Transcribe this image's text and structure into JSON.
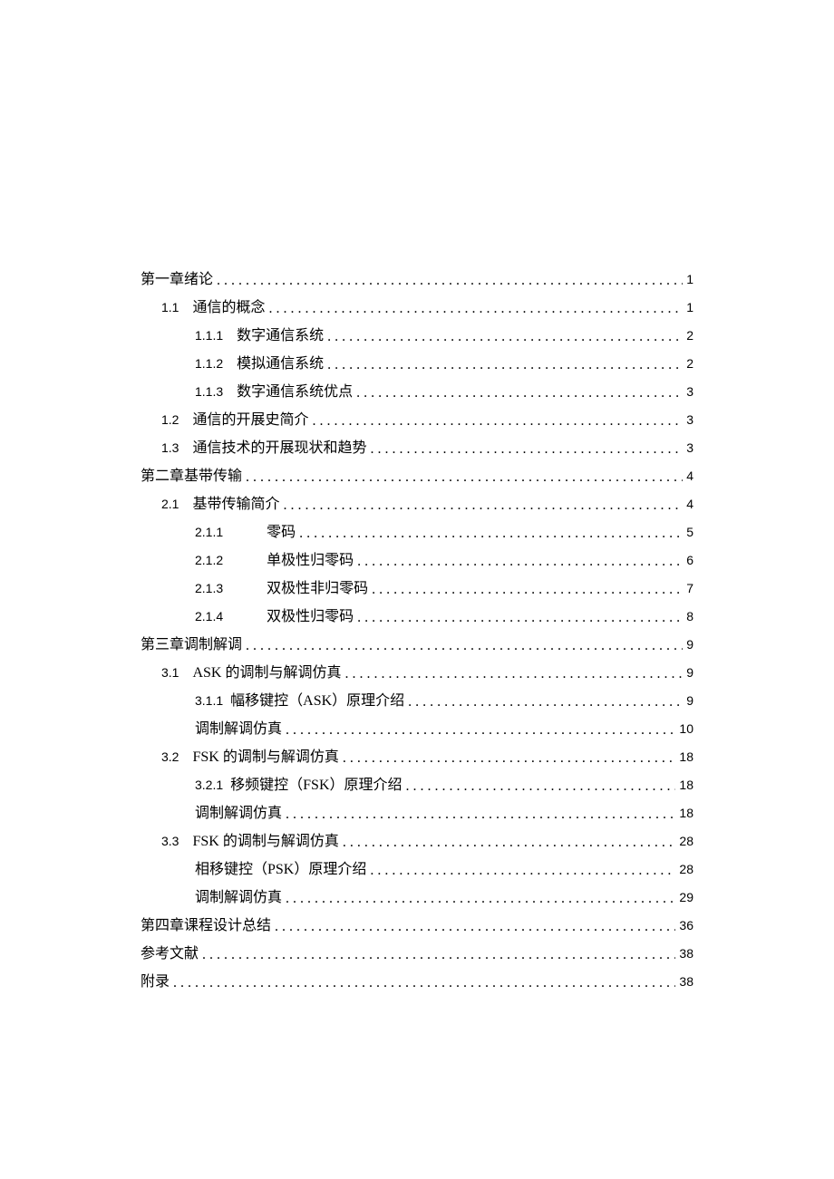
{
  "toc": [
    {
      "indent": 0,
      "num": "",
      "spacer": "sm",
      "title": "第一章绪论",
      "page": "1",
      "numClass": "",
      "titleClass": ""
    },
    {
      "indent": 1,
      "num": "1.1",
      "spacer": "med",
      "title": "通信的概念",
      "page": "1",
      "numClass": "arial",
      "titleClass": ""
    },
    {
      "indent": 2,
      "num": "1.1.1",
      "spacer": "med",
      "title": "数字通信系统",
      "page": "2",
      "numClass": "arial",
      "titleClass": ""
    },
    {
      "indent": 2,
      "num": "1.1.2",
      "spacer": "med",
      "title": "模拟通信系统",
      "page": "2",
      "numClass": "arial",
      "titleClass": ""
    },
    {
      "indent": 2,
      "num": "1.1.3",
      "spacer": "med",
      "title": "数字通信系统优点",
      "page": "3",
      "numClass": "arial",
      "titleClass": ""
    },
    {
      "indent": 1,
      "num": "1.2",
      "spacer": "med",
      "title": "通信的开展史简介",
      "page": "3",
      "numClass": "arial",
      "titleClass": ""
    },
    {
      "indent": 1,
      "num": "1.3",
      "spacer": "med",
      "title": "通信技术的开展现状和趋势",
      "page": "3",
      "numClass": "arial",
      "titleClass": ""
    },
    {
      "indent": 0,
      "num": "",
      "spacer": "sm",
      "title": "第二章基带传输",
      "page": "4",
      "numClass": "",
      "titleClass": ""
    },
    {
      "indent": 1,
      "num": "2.1",
      "spacer": "med",
      "title": "基带传输简介",
      "page": "4",
      "numClass": "arial",
      "titleClass": ""
    },
    {
      "indent": 2,
      "num": "2.1.1",
      "spacer": "wide",
      "title": "零码",
      "page": "5",
      "numClass": "arial",
      "titleClass": ""
    },
    {
      "indent": 2,
      "num": "2.1.2",
      "spacer": "wide",
      "title": "单极性归零码",
      "page": "6",
      "numClass": "arial",
      "titleClass": ""
    },
    {
      "indent": 2,
      "num": "2.1.3",
      "spacer": "wide",
      "title": "双极性非归零码",
      "page": "7",
      "numClass": "arial",
      "titleClass": ""
    },
    {
      "indent": 2,
      "num": "2.1.4",
      "spacer": "wide",
      "title": "双极性归零码",
      "page": "8",
      "numClass": "arial",
      "titleClass": ""
    },
    {
      "indent": 0,
      "num": "",
      "spacer": "sm",
      "title": "第三章调制解调",
      "page": "9",
      "numClass": "",
      "titleClass": ""
    },
    {
      "indent": 1,
      "num": "3.1",
      "spacer": "med",
      "title": "ASK 的调制与解调仿真",
      "page": "9",
      "numClass": "arial",
      "titleClass": ""
    },
    {
      "indent": 2,
      "num": "3.1.1",
      "spacer": "join",
      "title": "幅移键控（ASK）原理介绍",
      "page": "9",
      "numClass": "arial",
      "titleClass": ""
    },
    {
      "indent": 2,
      "num": "",
      "spacer": "sm",
      "title": "调制解调仿真",
      "page": "10",
      "numClass": "arial",
      "titleClass": ""
    },
    {
      "indent": 1,
      "num": "3.2",
      "spacer": "med",
      "title": "FSK 的调制与解调仿真",
      "page": "18",
      "numClass": "arial",
      "titleClass": ""
    },
    {
      "indent": 2,
      "num": "3.2.1",
      "spacer": "join",
      "title": "移频键控（FSK）原理介绍",
      "page": "18",
      "numClass": "arial",
      "titleClass": ""
    },
    {
      "indent": 2,
      "num": "",
      "spacer": "sm",
      "title": "调制解调仿真",
      "page": "18",
      "numClass": "arial",
      "titleClass": ""
    },
    {
      "indent": 1,
      "num": "3.3",
      "spacer": "med",
      "title": "FSK 的调制与解调仿真",
      "page": "28",
      "numClass": "arial",
      "titleClass": ""
    },
    {
      "indent": 2,
      "num": "",
      "spacer": "sm",
      "title": "相移键控（PSK）原理介绍",
      "page": "28",
      "numClass": "",
      "titleClass": ""
    },
    {
      "indent": 2,
      "num": "",
      "spacer": "sm",
      "title": "调制解调仿真",
      "page": "29",
      "numClass": "arial",
      "titleClass": ""
    },
    {
      "indent": 0,
      "num": "",
      "spacer": "sm",
      "title": "第四章课程设计总结",
      "page": "36",
      "numClass": "",
      "titleClass": ""
    },
    {
      "indent": 0,
      "num": "",
      "spacer": "sm",
      "title": "参考文献",
      "page": "38",
      "numClass": "",
      "titleClass": ""
    },
    {
      "indent": 0,
      "num": "",
      "spacer": "sm",
      "title": "附录",
      "page": "38",
      "numClass": "",
      "titleClass": ""
    }
  ]
}
